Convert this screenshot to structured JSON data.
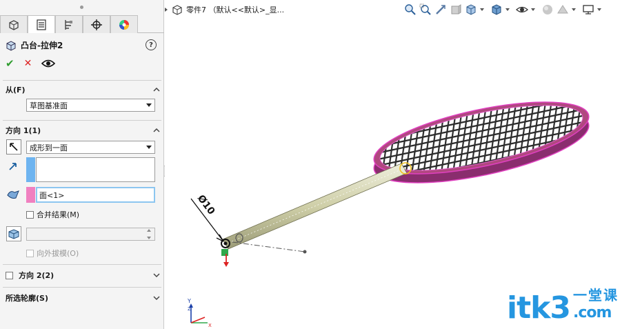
{
  "panel": {
    "feature_title": "凸台-拉伸2",
    "help_symbol": "?",
    "tabs": [
      "feature-manager-tab",
      "property-manager-tab",
      "configuration-manager-tab",
      "dimxpert-tab",
      "display-manager-tab"
    ],
    "from_section": {
      "title": "从(F)",
      "start_condition": "草图基准面"
    },
    "direction1": {
      "title": "方向 1(1)",
      "end_condition": "成形到一面",
      "face_selection": "面<1>",
      "merge_result_label": "合并结果(M)",
      "merge_result_checked": false,
      "draft_outward_label": "向外拔模(O)",
      "draft_outward_checked": false
    },
    "direction2": {
      "title": "方向 2(2)",
      "checked": false
    },
    "selected_contours": {
      "title": "所选轮廓(S)"
    }
  },
  "viewport": {
    "breadcrumb_text": "零件7 （默认<<默认>_显...",
    "dimension_label": "Ø10",
    "triad_axes": [
      "Y",
      "Z",
      "X"
    ]
  },
  "colors": {
    "face_selection_color": "#f080c0",
    "direction_bar_color": "#6eb4f0",
    "highlight_magenta": "#e040c0",
    "rod_color": "#d8d8b0",
    "watermark_blue": "#2596e0"
  },
  "watermark": {
    "main": "itk3",
    "cn": "一堂课",
    "com": ".com"
  }
}
